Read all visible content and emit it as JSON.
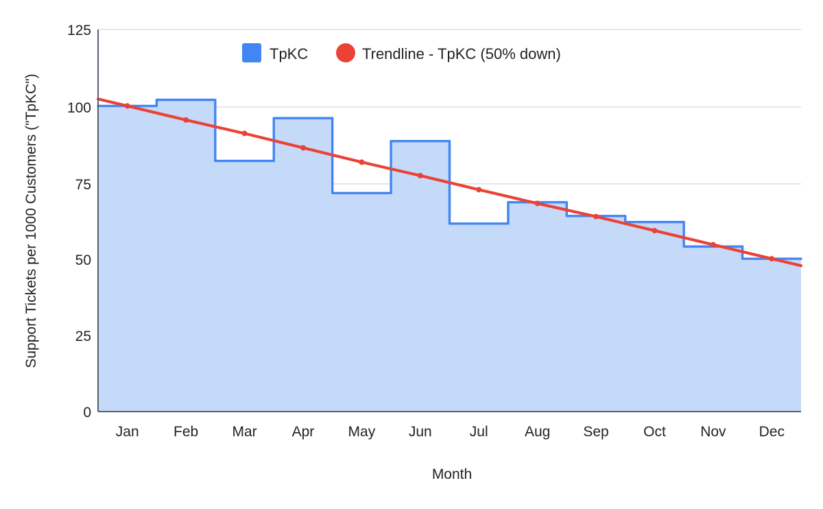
{
  "chart_data": {
    "type": "area",
    "title": "",
    "subtitle": "",
    "xlabel": "Month",
    "ylabel": "Support Tickets per 1000 Customers (\"TpKC\")",
    "categories": [
      "Jan",
      "Feb",
      "Mar",
      "Apr",
      "May",
      "Jun",
      "Jul",
      "Aug",
      "Sep",
      "Oct",
      "Nov",
      "Dec"
    ],
    "xlim": [
      0,
      12
    ],
    "ylim": [
      0,
      125
    ],
    "yticks": [
      0,
      25,
      50,
      75,
      100,
      125
    ],
    "ytick_labels": [
      "0",
      "25",
      "50",
      "75",
      "100",
      "125"
    ],
    "grid": true,
    "step_style": "hv",
    "legend_position": "top-center",
    "series": [
      {
        "name": "TpKC",
        "type": "stepped-area",
        "color": "#4285F4",
        "fill": "#c5d9f9",
        "values": [
          100,
          102,
          82,
          96,
          71.5,
          88.5,
          61.5,
          68.5,
          64,
          62,
          54,
          50
        ]
      },
      {
        "name": "Trendline - TpKC (50% down)",
        "type": "line",
        "color": "#EA4335",
        "marker": "circle",
        "values": [
          100,
          95.4,
          91.0,
          86.3,
          81.6,
          77.2,
          72.6,
          68.1,
          63.8,
          59.2,
          54.6,
          50.0
        ]
      }
    ],
    "legend": [
      {
        "label": "TpKC",
        "color": "#4285F4",
        "marker": "square"
      },
      {
        "label": "Trendline - TpKC (50% down)",
        "color": "#EA4335",
        "marker": "circle"
      }
    ]
  },
  "colors": {
    "series_blue": "#4285F4",
    "series_blue_fill": "#c5d9f9",
    "trendline_red": "#EA4335",
    "gridline": "#cccccc",
    "axis": "#555f6d",
    "text": "#222222",
    "background": "#ffffff"
  }
}
